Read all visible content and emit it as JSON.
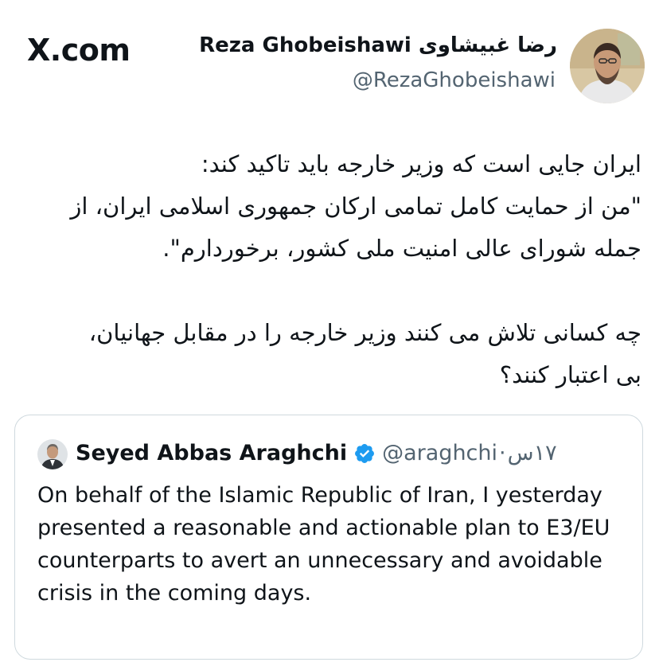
{
  "brand": "X.com",
  "author": {
    "name": "Reza Ghobeishawi رضا غبیشاوی",
    "handle": "@RezaGhobeishawi"
  },
  "tweet": {
    "paragraph1_lines": [
      "ایران جایی است که وزیر خارجه باید تاکید کند:",
      "\"من از حمایت کامل تمامی ارکان جمهوری اسلامی ایران، از",
      "جمله شورای عالی امنیت ملی کشور، برخوردارم\"."
    ],
    "paragraph2_lines": [
      "چه کسانی تلاش می کنند وزیر خارجه را در مقابل جهانیان،",
      "بی اعتبار کنند؟"
    ]
  },
  "quoted_tweet": {
    "author_name": "Seyed Abbas Araghchi",
    "handle": "@araghchi",
    "separator": "·",
    "time": "۱۷س",
    "text": "On behalf of the Islamic Republic of Iran, I yesterday presented a reasonable and actionable plan to E3/EU counterparts to avert an unnecessary and avoidable crisis in the coming days."
  },
  "colors": {
    "text_primary": "#0f1419",
    "text_secondary": "#536471",
    "verified_badge": "#1d9bf0",
    "card_border": "#cfd9de"
  },
  "icons": {
    "verified": "verified-badge-icon",
    "avatar_author": "author-avatar",
    "avatar_quoted": "quoted-author-avatar"
  }
}
